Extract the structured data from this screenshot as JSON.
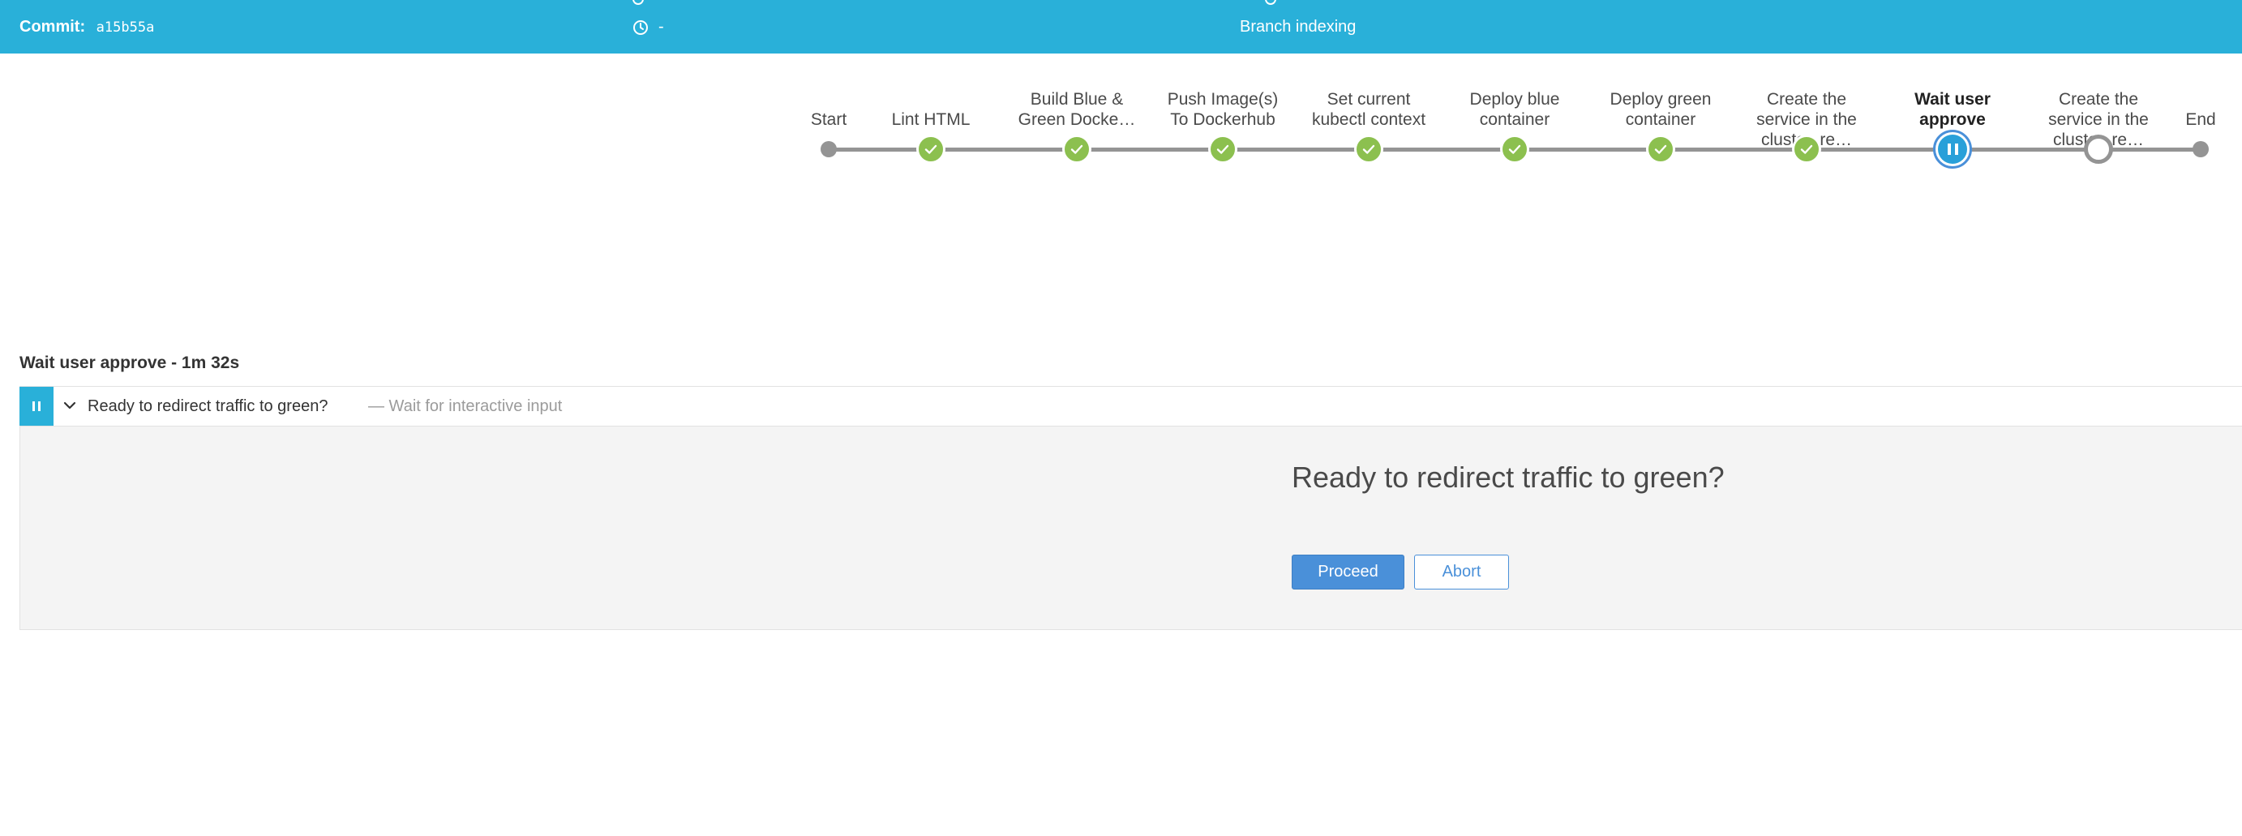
{
  "run_header": {
    "commit_label": "Commit:",
    "commit_hash": "a15b55a",
    "duration_value": "-",
    "cause": "Branch indexing"
  },
  "pipeline": {
    "stages": [
      {
        "label": "Start",
        "status": "start"
      },
      {
        "label": "Lint HTML",
        "status": "success"
      },
      {
        "label": "Build Blue & Green Docke…",
        "status": "success"
      },
      {
        "label": "Push Image(s) To Dockerhub",
        "status": "success"
      },
      {
        "label": "Set current kubectl context",
        "status": "success"
      },
      {
        "label": "Deploy blue container",
        "status": "success"
      },
      {
        "label": "Deploy green container",
        "status": "success"
      },
      {
        "label": "Create the service in the cluster, re…",
        "status": "success"
      },
      {
        "label": "Wait user approve",
        "status": "paused"
      },
      {
        "label": "Create the service in the cluster, re…",
        "status": "not_built"
      },
      {
        "label": "End",
        "status": "end"
      }
    ]
  },
  "step_detail": {
    "title": "Wait user approve - 1m 32s",
    "step_name": "Ready to redirect traffic to green?",
    "step_description": "— Wait for interactive input",
    "input": {
      "question": "Ready to redirect traffic to green?",
      "proceed_label": "Proceed",
      "abort_label": "Abort"
    }
  },
  "colors": {
    "header_bg": "#29b0d9",
    "success": "#8cc04f",
    "paused": "#4a90d9",
    "track": "#949494"
  }
}
